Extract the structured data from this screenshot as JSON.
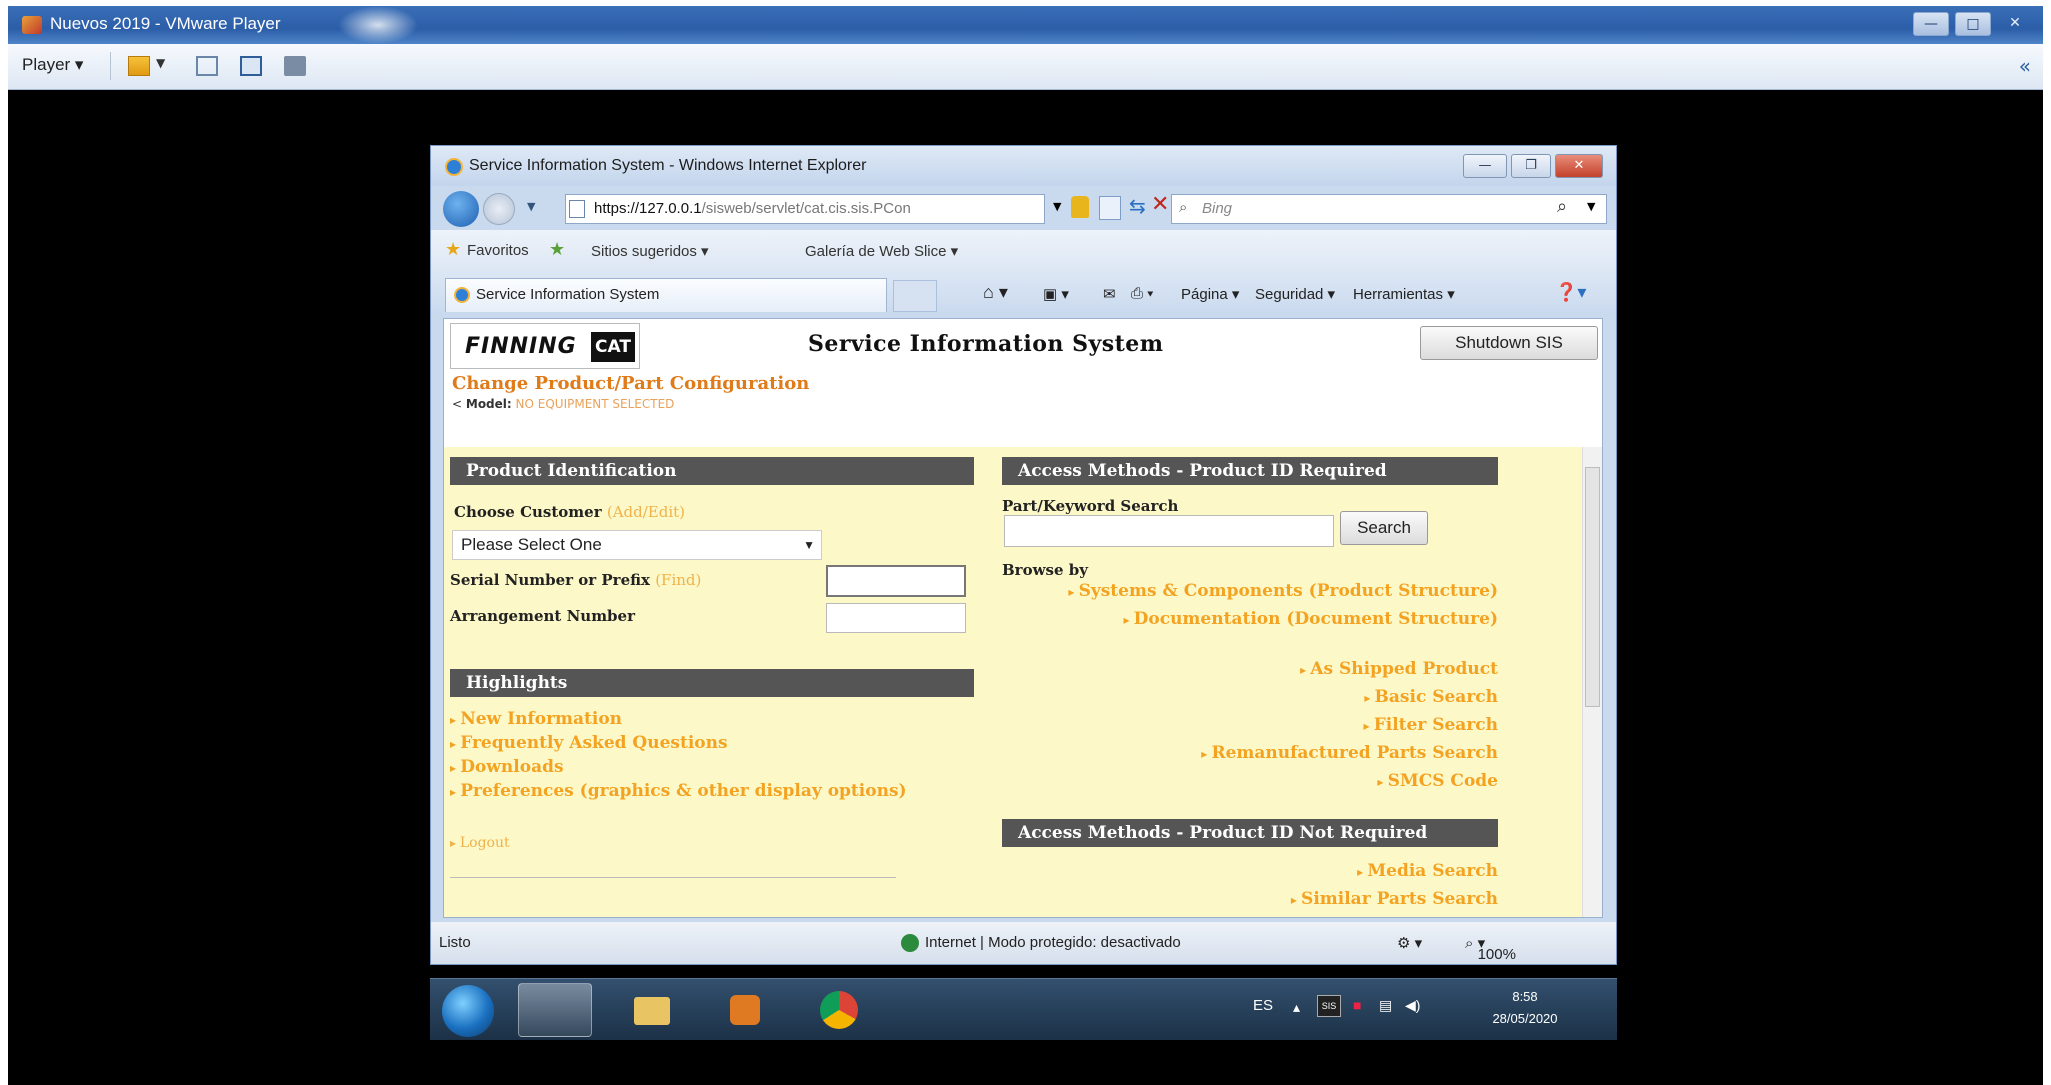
{
  "vm": {
    "title": "Nuevos 2019 - VMware Player",
    "player_label": "Player",
    "controls": [
      "—",
      "□",
      "✕"
    ]
  },
  "ie": {
    "title": "Service Information System - Windows Internet Explorer",
    "url_host": "https://127.0.0.1",
    "url_path": "/sisweb/servlet/cat.cis.sis.PCon",
    "search_placeholder": "Bing",
    "favorites": "Favoritos",
    "suggested_sites": "Sitios sugeridos ▾",
    "web_slice": "Galería de Web Slice ▾",
    "tab_title": "Service Information System",
    "cmd_page": "Página ▾",
    "cmd_security": "Seguridad ▾",
    "cmd_tools": "Herramientas ▾",
    "status_left": "Listo",
    "status_zone": "Internet | Modo protegido: desactivado",
    "zoom": "100%"
  },
  "sis": {
    "brand_word": "FINNING",
    "brand_cat": "CAT",
    "title": "Service Information System",
    "shutdown_label": "Shutdown SIS",
    "change_product": "Change Product/Part Configuration",
    "model_label": "Model:",
    "model_value": "NO EQUIPMENT SELECTED",
    "product_id": {
      "header": "Product Identification",
      "choose_customer": "Choose Customer",
      "add_edit": "(Add/Edit)",
      "customer_value": "Please Select One",
      "serial_label": "Serial Number or Prefix",
      "find": "(Find)",
      "arrangement_label": "Arrangement Number"
    },
    "highlights": {
      "header": "Highlights",
      "links": [
        "New Information",
        "Frequently Asked Questions",
        "Downloads",
        "Preferences (graphics & other display options)"
      ],
      "logout": "Logout"
    },
    "access_required": {
      "header": "Access Methods - Product ID Required",
      "search_label": "Part/Keyword Search",
      "search_button": "Search",
      "browse_label": "Browse by",
      "browse_links": [
        "Systems & Components (Product Structure)",
        "Documentation (Document Structure)"
      ],
      "links": [
        "As Shipped Product",
        "Basic Search",
        "Filter Search",
        "Remanufactured Parts Search",
        "SMCS Code"
      ]
    },
    "access_not_required": {
      "header": "Access Methods - Product ID Not Required",
      "links": [
        "Media Search",
        "Similar Parts Search"
      ]
    }
  },
  "taskbar": {
    "lang": "ES",
    "time": "8:58",
    "date": "28/05/2020"
  }
}
